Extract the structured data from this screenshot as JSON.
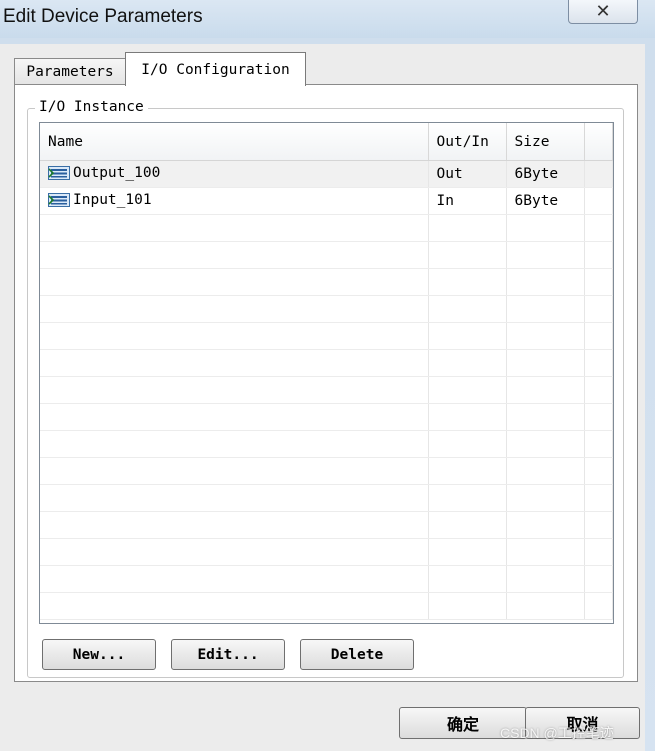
{
  "window": {
    "title": "Edit Device Parameters",
    "close_glyph": "✕"
  },
  "tabs": [
    {
      "label": "Parameters",
      "active": false
    },
    {
      "label": "I/O Configuration",
      "active": true
    }
  ],
  "group": {
    "label": "I/O Instance"
  },
  "table": {
    "columns": [
      "Name",
      "Out/In",
      "Size"
    ],
    "rows": [
      {
        "name": "Output_100",
        "direction": "Out",
        "size": "6Byte",
        "icon": "io-instance-icon",
        "selected": true
      },
      {
        "name": "Input_101",
        "direction": "In",
        "size": "6Byte",
        "icon": "io-instance-icon",
        "selected": false
      }
    ]
  },
  "buttons": {
    "new_label": "New...",
    "edit_label": "Edit...",
    "delete_label": "Delete"
  },
  "dialog_buttons": {
    "ok_label": "确定",
    "cancel_label": "取消"
  },
  "watermark": "CSDN @工控笔迹"
}
